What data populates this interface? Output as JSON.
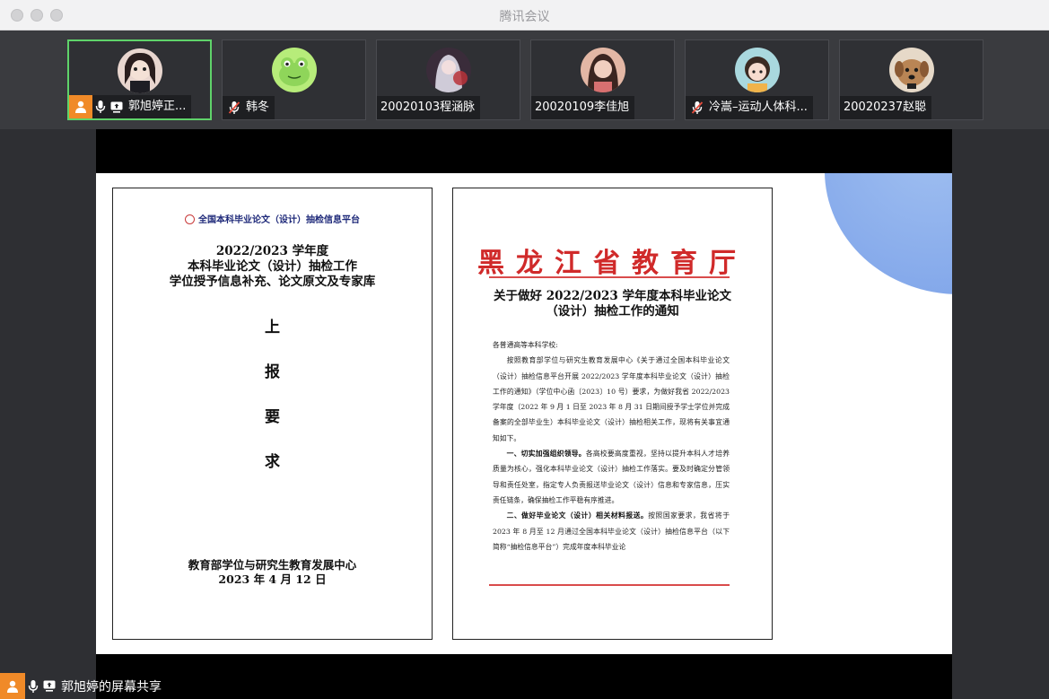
{
  "window": {
    "title": "腾讯会议"
  },
  "participants": [
    {
      "name": "郭旭婷正...",
      "host": true,
      "mic": "on",
      "sharing": true,
      "active": true,
      "avatar": "anime-girl-avatar"
    },
    {
      "name": "韩冬",
      "host": false,
      "mic": "muted",
      "sharing": false,
      "active": false,
      "avatar": "green-frog-avatar"
    },
    {
      "name": "20020103程涵脉",
      "host": false,
      "mic": "none",
      "sharing": false,
      "active": false,
      "avatar": "anime-character-avatar"
    },
    {
      "name": "20020109李佳旭",
      "host": false,
      "mic": "none",
      "sharing": false,
      "active": false,
      "avatar": "portrait-avatar"
    },
    {
      "name": "冷嵩–运动人体科...",
      "host": false,
      "mic": "muted",
      "sharing": false,
      "active": false,
      "avatar": "cartoon-girl-avatar"
    },
    {
      "name": "20020237赵聪",
      "host": false,
      "mic": "none",
      "sharing": false,
      "active": false,
      "avatar": "dog-avatar"
    }
  ],
  "page1": {
    "header": "全国本科毕业论文（设计）抽检信息平台",
    "title_lines": [
      "2022/2023 学年度",
      "本科毕业论文（设计）抽检工作",
      "学位授予信息补充、论文原文及专家库"
    ],
    "big_chars": [
      "上",
      "报",
      "要",
      "求"
    ],
    "footer_lines": [
      "教育部学位与研究生教育发展中心",
      "2023 年 4 月 12 日"
    ]
  },
  "page2": {
    "heading": "黑龙江省教育厅",
    "title_lines": [
      "关于做好 2022/2023 学年度本科毕业论文",
      "（设计）抽检工作的通知"
    ],
    "salutation": "各普通高等本科学校:",
    "para1": "按照教育部学位与研究生教育发展中心《关于通过全国本科毕业论文（设计）抽检信息平台开展 2022/2023 学年度本科毕业论文（设计）抽检工作的通知》（学位中心函〔2023〕10 号）要求，为做好我省 2022/2023 学年度（2022 年 9 月 1 日至 2023 年 8 月 31 日期间授予学士学位并完成备案的全部毕业生）本科毕业论文（设计）抽检相关工作，现将有关事宜通知如下。",
    "para2_head": "一、切实加强组织领导。",
    "para2": "各高校要高度重视，坚持以提升本科人才培养质量为核心，强化本科毕业论文（设计）抽检工作落实。要及时确定分管领导和责任处室，指定专人负责报送毕业论文（设计）信息和专家信息，压实责任链条，确保抽检工作平稳有序推进。",
    "para3_head": "二、做好毕业论文（设计）相关材料报送。",
    "para3": "按照国家要求，我省将于 2023 年 8 月至 12 月通过全国本科毕业论文（设计）抽检信息平台（以下简称“抽检信息平台”）完成年度本科毕业论"
  },
  "status_bar": {
    "label": "郭旭婷的屏幕共享"
  },
  "colors": {
    "active_border": "#5fd36a",
    "host_badge": "#f08a28",
    "heading_red": "#d02a2a"
  }
}
